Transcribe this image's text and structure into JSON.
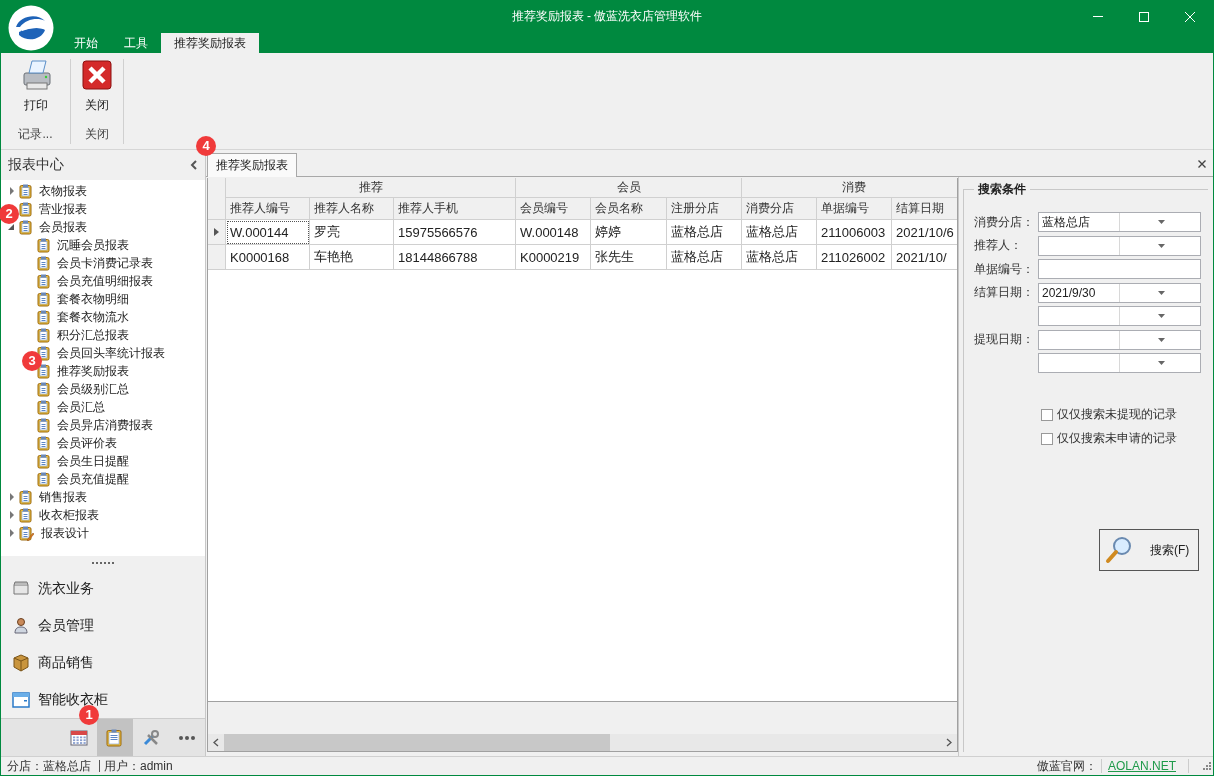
{
  "window": {
    "title": "推荐奖励报表 - 傲蓝洗衣店管理软件"
  },
  "menu_tabs": [
    {
      "label": "开始",
      "selected": false
    },
    {
      "label": "工具",
      "selected": false
    },
    {
      "label": "推荐奖励报表",
      "selected": true
    }
  ],
  "ribbon": {
    "groups": [
      {
        "label": "记录...",
        "buttons": [
          {
            "label": "打印"
          }
        ]
      },
      {
        "label": "关闭",
        "buttons": [
          {
            "label": "关闭"
          }
        ]
      }
    ]
  },
  "sidebar": {
    "title": "报表中心",
    "tree": [
      {
        "label": "衣物报表",
        "kind": "report",
        "expanded": false
      },
      {
        "label": "营业报表",
        "kind": "report"
      },
      {
        "label": "会员报表",
        "kind": "report",
        "expanded": true,
        "children": [
          {
            "label": "沉睡会员报表",
            "kind": "report"
          },
          {
            "label": "会员卡消费记录表",
            "kind": "report"
          },
          {
            "label": "会员充值明细报表",
            "kind": "report"
          },
          {
            "label": "套餐衣物明细",
            "kind": "report"
          },
          {
            "label": "套餐衣物流水",
            "kind": "report"
          },
          {
            "label": "积分汇总报表",
            "kind": "report"
          },
          {
            "label": "会员回头率统计报表",
            "kind": "report"
          },
          {
            "label": "推荐奖励报表",
            "kind": "report"
          },
          {
            "label": "会员级别汇总",
            "kind": "report"
          },
          {
            "label": "会员汇总",
            "kind": "report"
          },
          {
            "label": "会员异店消费报表",
            "kind": "report"
          },
          {
            "label": "会员评价表",
            "kind": "report"
          },
          {
            "label": "会员生日提醒",
            "kind": "report"
          },
          {
            "label": "会员充值提醒",
            "kind": "report"
          }
        ]
      },
      {
        "label": "销售报表",
        "kind": "report",
        "expanded": false
      },
      {
        "label": "收衣柜报表",
        "kind": "report",
        "expanded": false
      },
      {
        "label": "报表设计",
        "kind": "design",
        "expanded": false
      }
    ],
    "nav_items": [
      {
        "label": "洗衣业务"
      },
      {
        "label": "会员管理"
      },
      {
        "label": "商品销售"
      },
      {
        "label": "智能收衣柜"
      }
    ],
    "bottom_buttons": [
      {
        "kind": "calendar",
        "selected": false
      },
      {
        "kind": "reports",
        "selected": true
      },
      {
        "kind": "tools",
        "selected": false
      },
      {
        "kind": "more",
        "selected": false
      }
    ]
  },
  "document_tab": {
    "label": "推荐奖励报表",
    "selected": true
  },
  "table": {
    "groups": [
      {
        "label": "推荐",
        "columns": [
          "推荐人编号",
          "推荐人名称",
          "推荐人手机"
        ]
      },
      {
        "label": "会员",
        "columns": [
          "会员编号",
          "会员名称",
          "注册分店"
        ]
      },
      {
        "label": "消费",
        "columns": [
          "消费分店",
          "单据编号",
          "结算日期"
        ]
      }
    ],
    "rows": [
      {
        "current": true,
        "cells": [
          "W.000144",
          "罗亮",
          "15975566576",
          "W.000148",
          "婷婷",
          "蓝格总店",
          "蓝格总店",
          "211006003",
          "2021/10/6"
        ]
      },
      {
        "current": false,
        "cells": [
          "K0000168",
          "车艳艳",
          "18144866788",
          "K0000219",
          "张先生",
          "蓝格总店",
          "蓝格总店",
          "211026002",
          "2021/10/"
        ]
      }
    ]
  },
  "search": {
    "title": "搜索条件",
    "fields": [
      {
        "label": "消费分店：",
        "kind": "combo",
        "value": "蓝格总店"
      },
      {
        "label": "推荐人：",
        "kind": "combo"
      },
      {
        "label": "单据编号：",
        "kind": "text"
      },
      {
        "label": "结算日期：",
        "kind": "combo",
        "value": "2021/9/30"
      },
      {
        "kind": "combo"
      },
      {
        "label": "提现日期：",
        "kind": "combo"
      },
      {
        "kind": "combo"
      }
    ],
    "checkboxes": [
      {
        "label": "仅仅搜索未提现的记录",
        "checked": false
      },
      {
        "label": "仅仅搜索未申请的记录",
        "checked": false
      }
    ],
    "button": "搜索(F)"
  },
  "status_bar": {
    "items": [
      "分店：蓝格总店",
      "用户：admin"
    ],
    "site_label": "傲蓝官网：",
    "site_link": "AOLAN.NET"
  },
  "annotation_markers": [
    "1",
    "2",
    "3",
    "4"
  ]
}
